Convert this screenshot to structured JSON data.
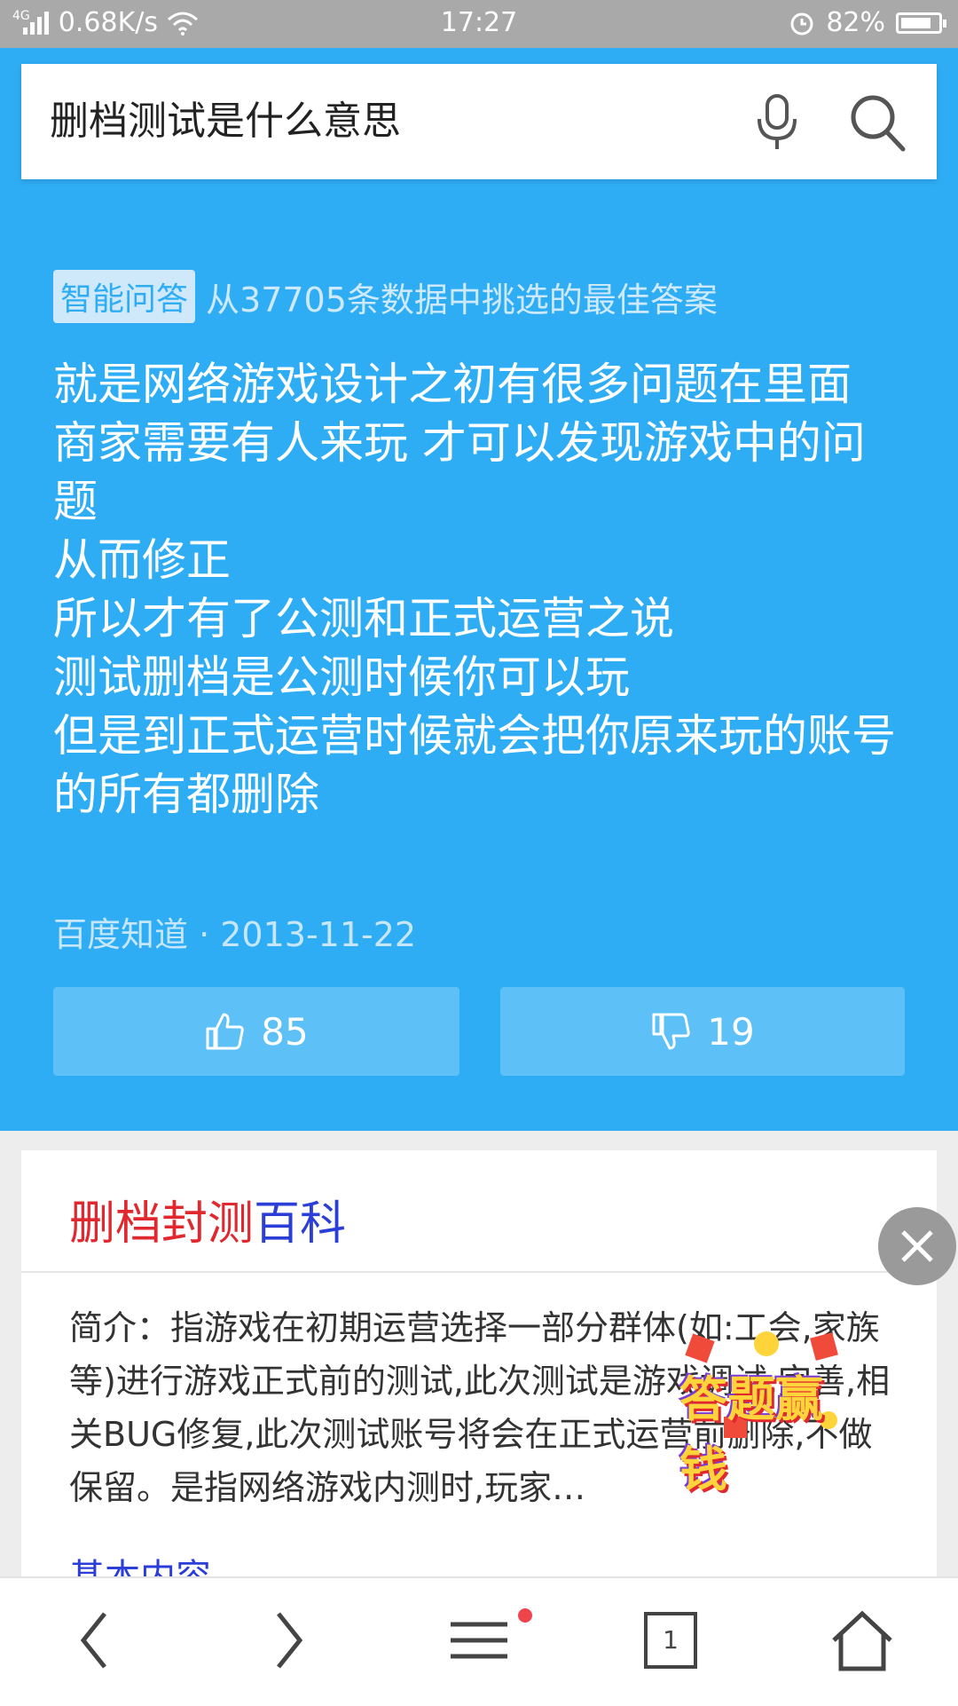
{
  "status_bar": {
    "network": "4G",
    "speed": "0.68K/s",
    "time": "17:27",
    "battery": "82%",
    "battery_level": 0.82
  },
  "search": {
    "query": "删档测试是什么意思"
  },
  "answer": {
    "tag": "智能问答",
    "tag_desc": "从37705条数据中挑选的最佳答案",
    "lines": [
      "就是网络游戏设计之初有很多问题在里面",
      "商家需要有人来玩 才可以发现游戏中的问题",
      "从而修正",
      "所以才有了公测和正式运营之说",
      "测试删档是公测时候你可以玩",
      "但是到正式运营时候就会把你原来玩的账号的所有都删除"
    ],
    "source": "百度知道 · 2013-11-22",
    "upvotes": "85",
    "downvotes": "19"
  },
  "card": {
    "title_red": "删档封测",
    "title_blue": "百科",
    "body": "简介：指游戏在初期运营选择一部分群体(如:工会,家族等)进行游戏正式前的测试,此次测试是游戏调试,完善,相关BUG修复,此次测试账号将会在正式运营前删除,不做保留。是指网络游戏内测时,玩家…",
    "more_link": "基本内容"
  },
  "promo": {
    "label": "答题赢钱"
  },
  "bottom_nav": {
    "tab_count": "1"
  },
  "colors": {
    "accent_blue": "#2eadf5",
    "title_red": "#e0282e",
    "link_blue": "#2b3ed8"
  },
  "icons": [
    "signal-icon",
    "wifi-icon",
    "alarm-icon",
    "battery-icon",
    "microphone-icon",
    "search-icon",
    "thumbs-up-icon",
    "thumbs-down-icon",
    "close-icon",
    "back-icon",
    "forward-icon",
    "menu-icon",
    "tabs-icon",
    "home-icon"
  ]
}
